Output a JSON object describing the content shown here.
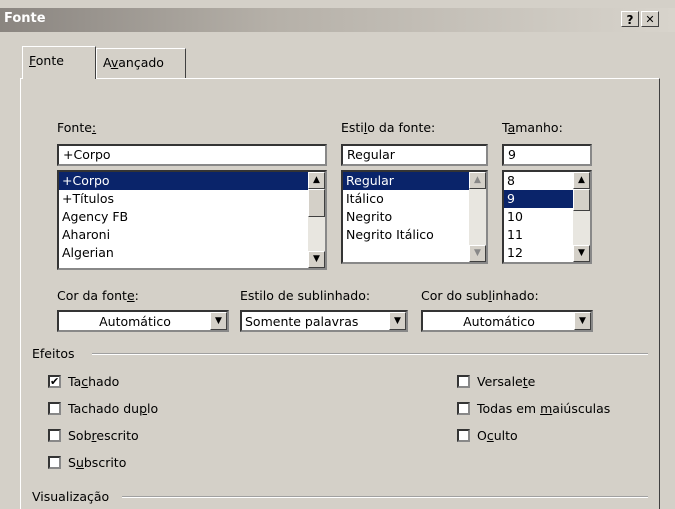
{
  "window": {
    "title": "Fonte",
    "help_label": "?",
    "close_label": "✕"
  },
  "tabs": [
    {
      "pre": "",
      "key": "F",
      "post": "onte"
    },
    {
      "pre": "A",
      "key": "v",
      "post": "ançado"
    }
  ],
  "font": {
    "label_pre": "Fonte",
    "label_key": ":",
    "value": "+Corpo",
    "items": [
      "+Corpo",
      "+Títulos",
      "Agency FB",
      "Aharoni",
      "Algerian"
    ]
  },
  "style": {
    "label_pre": "Esti",
    "label_key": "l",
    "label_post": "o da fonte:",
    "value": "Regular",
    "items": [
      "Regular",
      "Itálico",
      "Negrito",
      "Negrito Itálico"
    ]
  },
  "size": {
    "label_pre": "T",
    "label_key": "a",
    "label_post": "manho:",
    "value": "9",
    "items": [
      "8",
      "9",
      "10",
      "11",
      "12"
    ]
  },
  "font_color": {
    "label_pre": "Cor da font",
    "label_key": "e",
    "label_post": ":",
    "value": "Automático"
  },
  "underline_style": {
    "label": "Estilo de sublinhado:",
    "value": "Somente palavras"
  },
  "underline_color": {
    "label_pre": "Cor do sub",
    "label_key": "l",
    "label_post": "inhado:",
    "value": "Automático"
  },
  "effects": {
    "label": "Efeitos",
    "left": [
      {
        "pre": "Ta",
        "key": "c",
        "post": "hado",
        "checked": true
      },
      {
        "pre": "Tachado du",
        "key": "p",
        "post": "lo",
        "checked": false
      },
      {
        "pre": "Sob",
        "key": "r",
        "post": "escrito",
        "checked": false
      },
      {
        "pre": "S",
        "key": "u",
        "post": "bscrito",
        "checked": false
      }
    ],
    "right": [
      {
        "pre": "Versale",
        "key": "t",
        "post": "e",
        "checked": false
      },
      {
        "pre": "Todas em ",
        "key": "m",
        "post": "aiúsculas",
        "checked": false
      },
      {
        "pre": "O",
        "key": "c",
        "post": "ulto",
        "checked": false
      }
    ]
  },
  "preview": {
    "label": "Visualização"
  },
  "check_mark": "✔",
  "arrows": {
    "up": "▲",
    "down": "▼"
  }
}
